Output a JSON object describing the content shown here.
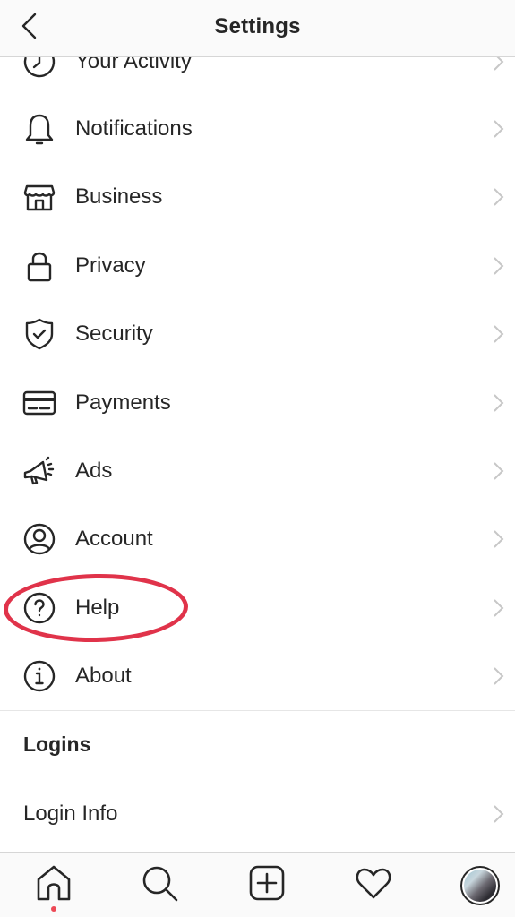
{
  "header": {
    "title": "Settings",
    "back_icon": "chevron-left-icon"
  },
  "menu": {
    "items": [
      {
        "label": "Your Activity",
        "icon": "activity-icon"
      },
      {
        "label": "Notifications",
        "icon": "bell-icon"
      },
      {
        "label": "Business",
        "icon": "storefront-icon"
      },
      {
        "label": "Privacy",
        "icon": "lock-icon"
      },
      {
        "label": "Security",
        "icon": "shield-check-icon"
      },
      {
        "label": "Payments",
        "icon": "credit-card-icon"
      },
      {
        "label": "Ads",
        "icon": "megaphone-icon"
      },
      {
        "label": "Account",
        "icon": "user-circle-icon"
      },
      {
        "label": "Help",
        "icon": "question-circle-icon",
        "highlighted": true
      },
      {
        "label": "About",
        "icon": "info-circle-icon"
      }
    ]
  },
  "logins": {
    "section_title": "Logins",
    "items": [
      {
        "label": "Login Info"
      }
    ]
  },
  "annotation": {
    "highlight_color": "#e0334a",
    "highlighted_item": "Help"
  },
  "tabbar": {
    "items": [
      {
        "name": "home",
        "icon": "home-icon",
        "active": true,
        "notification_dot": true
      },
      {
        "name": "search",
        "icon": "search-icon"
      },
      {
        "name": "new-post",
        "icon": "plus-square-icon"
      },
      {
        "name": "activity",
        "icon": "heart-icon"
      },
      {
        "name": "profile",
        "icon": "avatar"
      }
    ],
    "dot_color": "#ed4956"
  }
}
